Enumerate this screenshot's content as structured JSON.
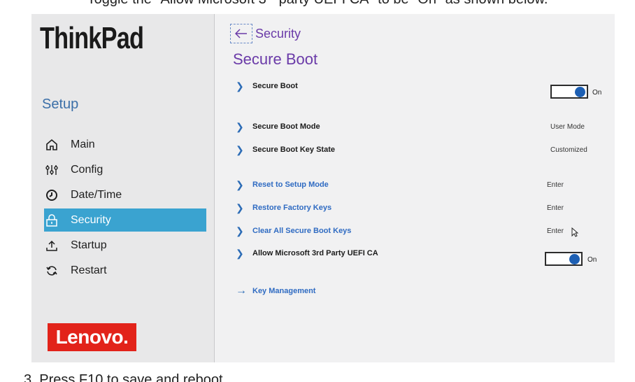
{
  "captions": {
    "top": "Toggle the \"Allow Microsoft 3ʳᵈ party UEFI CA\" to be \"On\" as shown below.",
    "bottom": "3.   Press F10 to save and reboot."
  },
  "sidebar": {
    "brand": "ThinkPad",
    "setup_title": "Setup",
    "items": [
      {
        "label": "Main",
        "icon": "home-icon"
      },
      {
        "label": "Config",
        "icon": "sliders-icon"
      },
      {
        "label": "Date/Time",
        "icon": "clock-icon"
      },
      {
        "label": "Security",
        "icon": "lock-icon",
        "active": true
      },
      {
        "label": "Startup",
        "icon": "upload-icon"
      },
      {
        "label": "Restart",
        "icon": "restart-icon"
      }
    ],
    "logo": "Lenovo."
  },
  "main": {
    "back_label": "Security",
    "page_title": "Secure Boot",
    "rows": [
      {
        "label": "Secure Boot",
        "toggle": "On"
      },
      {
        "label": "Secure Boot Mode",
        "value": "User Mode"
      },
      {
        "label": "Secure Boot Key State",
        "value": "Customized"
      },
      {
        "label": "Reset to Setup Mode",
        "value": "Enter"
      },
      {
        "label": "Restore Factory Keys",
        "value": "Enter"
      },
      {
        "label": "Clear All Secure Boot Keys",
        "value": "Enter"
      },
      {
        "label": "Allow Microsoft 3rd Party UEFI CA",
        "toggle": "On"
      },
      {
        "label": "Key Management"
      }
    ]
  },
  "colors": {
    "accent": "#3aa3d0",
    "title_purple": "#6a3aa8",
    "link_blue": "#2f6bc2",
    "toggle_on": "#1d5fb3",
    "lenovo_red": "#e2231a"
  }
}
